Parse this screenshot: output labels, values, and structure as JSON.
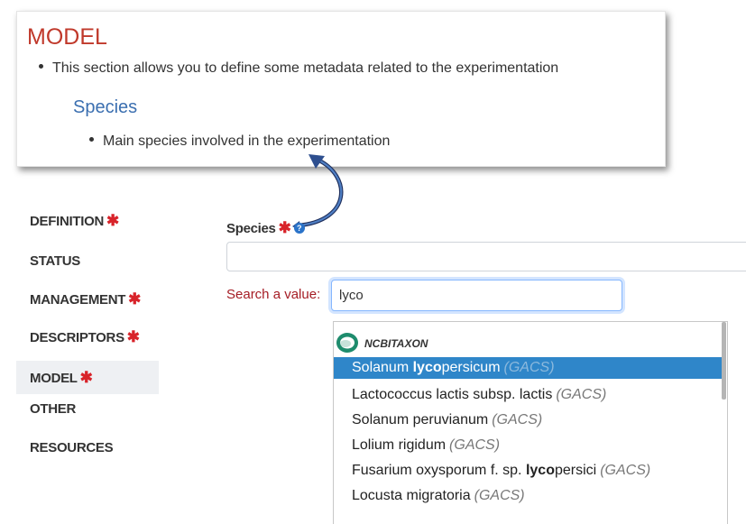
{
  "help_panel": {
    "title": "MODEL",
    "description": "This section allows you to define some metadata related to the experimentation",
    "subtitle": "Species",
    "subtitle_description": "Main species involved in the experimentation"
  },
  "sidebar": {
    "items": [
      {
        "label": "DEFINITION",
        "required": true,
        "active": false
      },
      {
        "label": "STATUS",
        "required": false,
        "active": false
      },
      {
        "label": "MANAGEMENT",
        "required": true,
        "active": false
      },
      {
        "label": "DESCRIPTORS",
        "required": true,
        "active": false
      },
      {
        "label": "MODEL",
        "required": true,
        "active": true
      },
      {
        "label": "OTHER",
        "required": false,
        "active": false
      },
      {
        "label": "RESOURCES",
        "required": false,
        "active": false
      }
    ],
    "required_marker": "✱"
  },
  "form": {
    "species_label": "Species",
    "required_marker": "✱",
    "help_icon": "?",
    "species_value": "",
    "search_label": "Search a value:",
    "search_value": "lyco"
  },
  "dropdown": {
    "source": "NCBITAXON",
    "items": [
      {
        "pre": "Solanum ",
        "match": "lyco",
        "post": "persicum",
        "tag": "(GACS)",
        "selected": true
      },
      {
        "pre": "Lactococcus lactis subsp. lactis",
        "match": "",
        "post": "",
        "tag": "(GACS)",
        "selected": false
      },
      {
        "pre": "Solanum peruvianum",
        "match": "",
        "post": "",
        "tag": "(GACS)",
        "selected": false
      },
      {
        "pre": "Lolium rigidum",
        "match": "",
        "post": "",
        "tag": "(GACS)",
        "selected": false
      },
      {
        "pre": "Fusarium oxysporum f. sp. ",
        "match": "lyco",
        "post": "persici",
        "tag": "(GACS)",
        "selected": false
      },
      {
        "pre": "Locusta migratoria",
        "match": "",
        "post": "",
        "tag": "(GACS)",
        "selected": false
      }
    ]
  },
  "colors": {
    "accent": "#2f86c9",
    "title_red": "#c0392b",
    "required_red": "#d8232a",
    "subtitle_blue": "#3b6fb0"
  }
}
